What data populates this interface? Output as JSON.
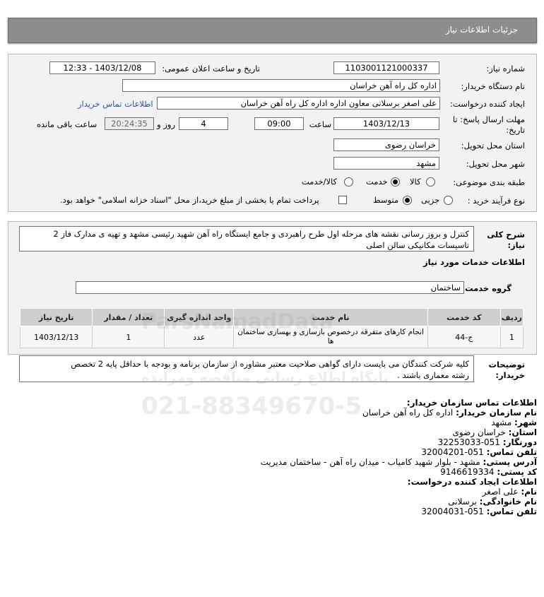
{
  "header": {
    "title": "جزئیات اطلاعات نیاز"
  },
  "form": {
    "need_number_label": "شماره نیاز:",
    "need_number": "1103001121000337",
    "announce_label": "تاریخ و ساعت اعلان عمومی:",
    "announce_value": "1403/12/08 - 12:33",
    "buyer_org_label": "نام دستگاه خریدار:",
    "buyer_org": "اداره کل راه آهن خراسان",
    "creator_label": "ایجاد کننده درخواست:",
    "creator": "علی اصغر برسلانی معاون اداره اداره کل راه آهن خراسان",
    "contact_link": "اطلاعات تماس خریدار",
    "deadline_label_line1": "مهلت ارسال پاسخ: تا",
    "deadline_label_line2": "تاریخ:",
    "deadline_date": "1403/12/13",
    "time_label": "ساعت",
    "deadline_time": "09:00",
    "days_value": "4",
    "days_label": "روز و",
    "remaining_time": "20:24:35",
    "remaining_label": "ساعت باقی مانده",
    "province_label": "استان محل تحویل:",
    "province": "خراسان رضوی",
    "city_label": "شهر محل تحویل:",
    "city": "مشهد",
    "category_label": "طبقه بندی موضوعی:",
    "category_options": [
      "کالا",
      "خدمت",
      "کالا/خدمت"
    ],
    "category_selected": "خدمت",
    "process_label": "نوع فرآیند خرید :",
    "process_options": [
      "جزیی",
      "متوسط"
    ],
    "process_selected": "متوسط",
    "payment_note": "پرداخت تمام یا بخشی از مبلغ خرید،از محل \"اسناد خزانه اسلامی\" خواهد بود."
  },
  "description": {
    "label_line1": "شرح کلی",
    "label_line2": "نیاز:",
    "text_line1": "کنترل و بروز رسانی نقشه های مرحله اول طرح راهبردی و جامع ایستگاه راه آهن شهید رئیسی مشهد و تهیه ی مدارک فاز 2",
    "text_line2": "تاسیسات مکانیکی سالن اصلی"
  },
  "services": {
    "section_title": "اطلاعات خدمات مورد نیاز",
    "group_label": "گروه خدمت:",
    "group_value": "ساختمان",
    "columns": [
      "ردیف",
      "کد خدمت",
      "نام خدمت",
      "واحد اندازه گیری",
      "تعداد / مقدار",
      "تاریخ نیاز"
    ],
    "rows": [
      {
        "row": "1",
        "code": "ج-44",
        "name": "انجام کارهای متفرقه درخصوص بازسازی و بهسازی ساختمان ها",
        "unit": "عدد",
        "qty": "1",
        "date": "1403/12/13"
      }
    ]
  },
  "buyer_notes": {
    "label_line1": "توضیحات",
    "label_line2": "خریدار:",
    "text_line1": "کلیه شرکت کنندگان می بایست دارای گواهی صلاحیت معتبر مشاوره از سازمان برنامه و بودجه با حداقل پایه 2 تخصص",
    "text_line2": "رشته معماری باشند ."
  },
  "contact": {
    "buyer_title": "اطلاعات تماس سازمان خریدار:",
    "org_label": "نام سازمان خریدار:",
    "org": "اداره کل راه آهن خراسان",
    "city_label": "شهر:",
    "city": "مشهد",
    "province_label": "استان:",
    "province": "خراسان رضوی",
    "fax_label": "دورنگار:",
    "fax": "051-32253033",
    "phone_label": "تلفن تماس:",
    "phone": "051-32004201",
    "address_label": "آدرس پستی:",
    "address": "مشهد - بلوار شهید کامیاب - میدان راه آهن - ساختمان مدیریت",
    "postal_label": "کد پستی:",
    "postal": "9146619334",
    "creator_title": "اطلاعات ایجاد کننده درخواست:",
    "first_name_label": "نام:",
    "first_name": "علی اصغر",
    "last_name_label": "نام خانوادگی:",
    "last_name": "برسلانی",
    "creator_phone_label": "تلفن تماس:",
    "creator_phone": "051-32004031"
  },
  "watermark": {
    "brand": "ParsNamadData",
    "subtitle": "پایگاه اطلاع رسانی مناقصه ومزایده",
    "phone": "021-88349670-5"
  }
}
